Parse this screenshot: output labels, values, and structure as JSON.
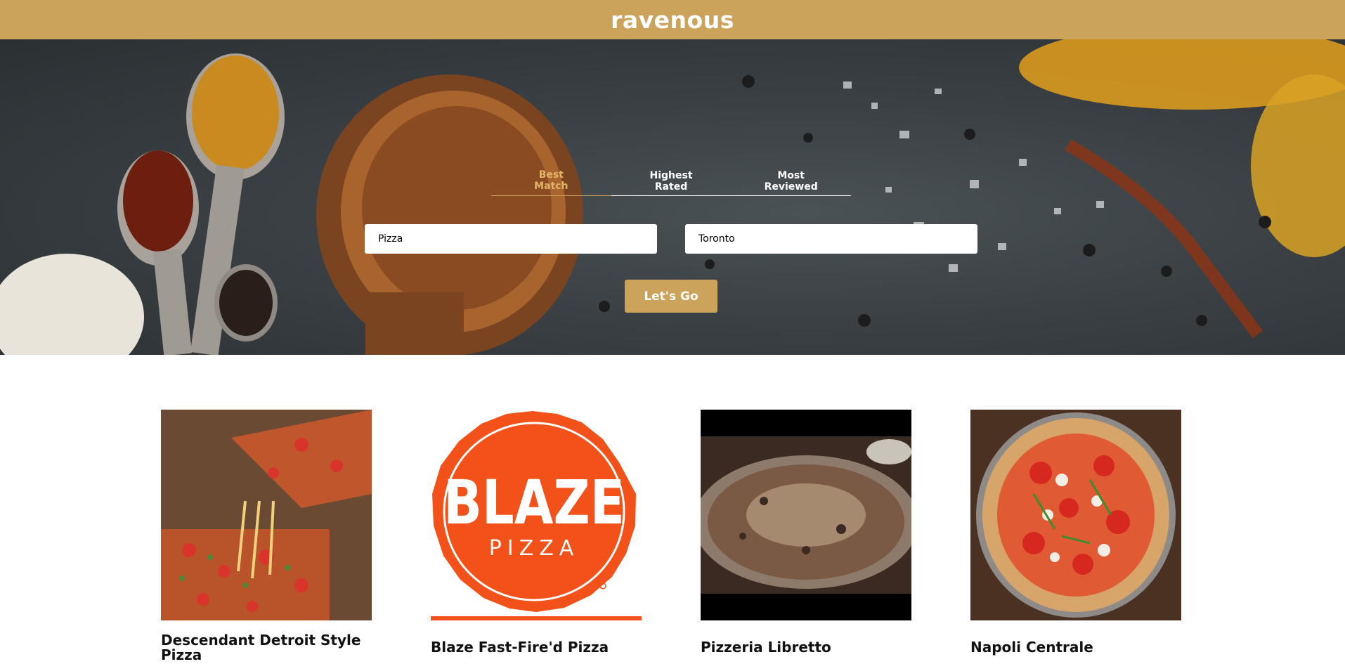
{
  "header": {
    "brand": "ravenous"
  },
  "hero": {
    "sort_options": [
      {
        "label": "Best\nMatch",
        "active": true
      },
      {
        "label": "Highest\nRated",
        "active": false
      },
      {
        "label": "Most\nReviewed",
        "active": false
      }
    ],
    "search_term": {
      "value": "Pizza"
    },
    "location": {
      "value": "Toronto"
    },
    "submit_label": "Let's Go"
  },
  "businesses": [
    {
      "name": "Descendant Detroit Style Pizza",
      "image_icon": "pizza-photo"
    },
    {
      "name": "Blaze Fast-Fire'd Pizza",
      "image_icon": "blaze-logo",
      "logo_text": "BLAZE",
      "logo_subtext": "PIZZA"
    },
    {
      "name": "Pizzeria Libretto",
      "image_icon": "pizza-photo"
    },
    {
      "name": "Napoli Centrale",
      "image_icon": "pizza-photo"
    }
  ],
  "colors": {
    "accent": "#cca35a",
    "active_tab": "#e3b567",
    "blaze_orange": "#f2521a"
  }
}
